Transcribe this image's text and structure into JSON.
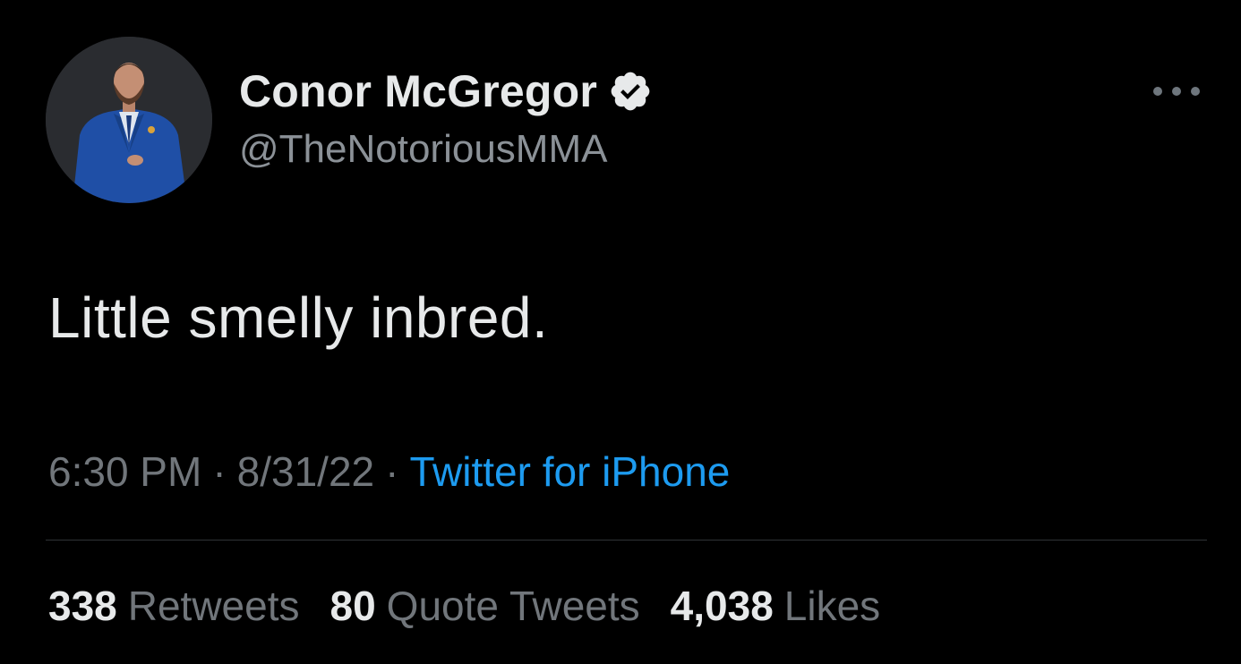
{
  "tweet": {
    "author": {
      "display_name": "Conor McGregor",
      "handle": "@TheNotoriousMMA",
      "verified": true,
      "avatar_icon": "profile-photo"
    },
    "more_icon": "more-horizontal-icon",
    "text": "Little smelly inbred.",
    "meta": {
      "time": "6:30 PM",
      "separator": "·",
      "date": "8/31/22",
      "source": "Twitter for iPhone"
    },
    "stats": {
      "retweets_count": "338",
      "retweets_label": "Retweets",
      "quotes_count": "80",
      "quotes_label": "Quote Tweets",
      "likes_count": "4,038",
      "likes_label": "Likes"
    }
  },
  "colors": {
    "background": "#000000",
    "primary_text": "#e7e9ea",
    "secondary_text": "#71767b",
    "accent": "#1d9bf0",
    "divider": "#2f3336"
  }
}
